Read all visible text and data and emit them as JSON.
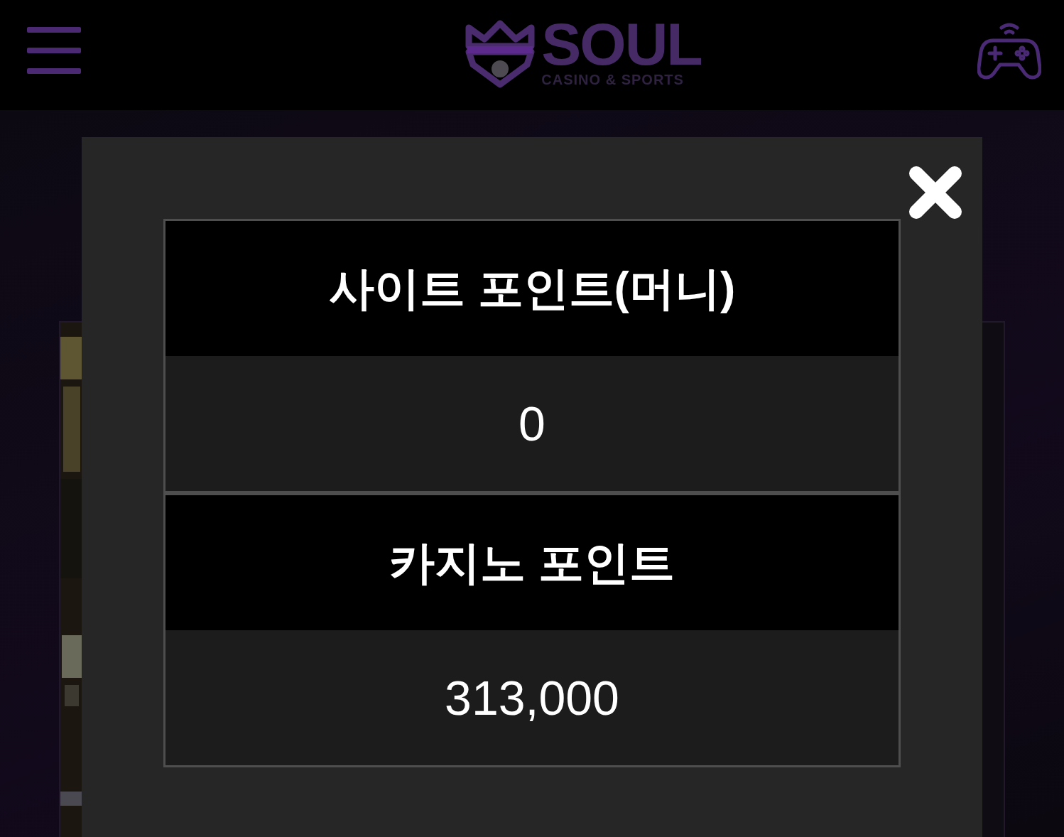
{
  "header": {
    "logo": {
      "title": "SOUL",
      "subtitle": "CASINO & SPORTS"
    }
  },
  "modal": {
    "sections": [
      {
        "label": "사이트 포인트(머니)",
        "value": "0"
      },
      {
        "label": "카지노 포인트",
        "value": "313,000"
      }
    ]
  }
}
